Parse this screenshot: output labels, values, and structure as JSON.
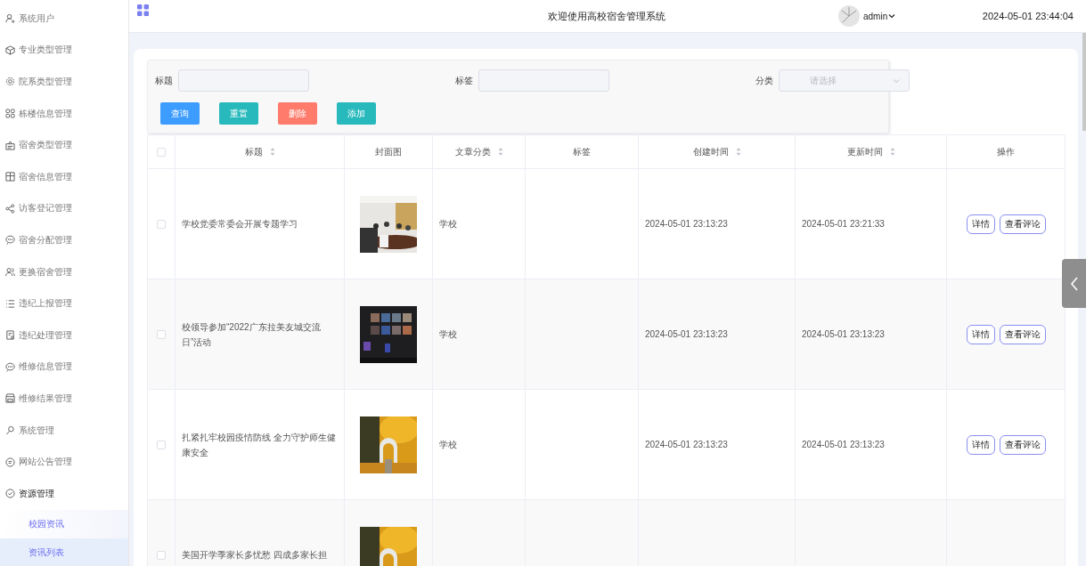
{
  "sidebar": {
    "items": [
      {
        "label": "系统用户",
        "expanded": false
      },
      {
        "label": "专业类型管理",
        "expanded": false
      },
      {
        "label": "院系类型管理",
        "expanded": false
      },
      {
        "label": "栋楼信息管理",
        "expanded": false
      },
      {
        "label": "宿舍类型管理",
        "expanded": false
      },
      {
        "label": "宿舍信息管理",
        "expanded": false
      },
      {
        "label": "访客登记管理",
        "expanded": false
      },
      {
        "label": "宿舍分配管理",
        "expanded": false
      },
      {
        "label": "更换宿舍管理",
        "expanded": false
      },
      {
        "label": "违纪上报管理",
        "expanded": false
      },
      {
        "label": "违纪处理管理",
        "expanded": false
      },
      {
        "label": "维修信息管理",
        "expanded": false
      },
      {
        "label": "维修结果管理",
        "expanded": false
      },
      {
        "label": "系统管理",
        "expanded": false
      },
      {
        "label": "网站公告管理",
        "expanded": false
      },
      {
        "label": "资源管理",
        "expanded": true,
        "children": [
          {
            "label": "校园资讯",
            "selected": false
          },
          {
            "label": "资讯列表",
            "selected": true
          }
        ]
      }
    ]
  },
  "header": {
    "title": "欢迎使用高校宿舍管理系统",
    "user": "admin",
    "datetime": "2024-05-01 23:44:04"
  },
  "filters": [
    {
      "label": "标题",
      "kind": "input"
    },
    {
      "label": "标签",
      "kind": "input"
    },
    {
      "label": "分类",
      "kind": "select",
      "placeholder": "请选择"
    }
  ],
  "buttons": [
    {
      "label": "查询",
      "color": "#3d9cff"
    },
    {
      "label": "重置",
      "color": "#27b9bb"
    },
    {
      "label": "删除",
      "color": "#ff7b6c"
    },
    {
      "label": "添加",
      "color": "#27b9bb"
    }
  ],
  "table": {
    "header_checkbox": {
      "checked": false
    },
    "columns": [
      {
        "label": "标题",
        "sortable": true
      },
      {
        "label": "封面图",
        "sortable": false
      },
      {
        "label": "文章分类",
        "sortable": true
      },
      {
        "label": "标签",
        "sortable": false
      },
      {
        "label": "创建时间",
        "sortable": true
      },
      {
        "label": "更新时间",
        "sortable": true
      },
      {
        "label": "操作",
        "sortable": false
      }
    ],
    "rows": [
      {
        "checked": false,
        "title": "学校党委常委会开展专题学习",
        "cover": {
          "kind": "picture"
        },
        "category": "学校",
        "created": "2024-05-01 23:13:23",
        "updated": "2024-05-01 23:21:33",
        "actions": [
          "详情",
          "查看评论"
        ]
      },
      {
        "checked": false,
        "title": "校领导参加“2022广东拉美友城交流日”活动",
        "cover": {
          "kind": "picture"
        },
        "category": "学校",
        "created": "2024-05-01 23:13:23",
        "updated": "2024-05-01 23:13:23",
        "actions": [
          "详情",
          "查看评论"
        ]
      },
      {
        "checked": false,
        "title": "扎紧扎牢校园疫情防线 全力守护师生健康安全",
        "cover": {
          "kind": "picture"
        },
        "category": "学校",
        "created": "2024-05-01 23:13:23",
        "updated": "2024-05-01 23:13:23",
        "actions": [
          "详情",
          "查看评论"
        ]
      },
      {
        "checked": false,
        "title": "美国开学季家长多忧愁 四成多家长担",
        "cover": {
          "kind": "picture"
        }
      }
    ]
  }
}
